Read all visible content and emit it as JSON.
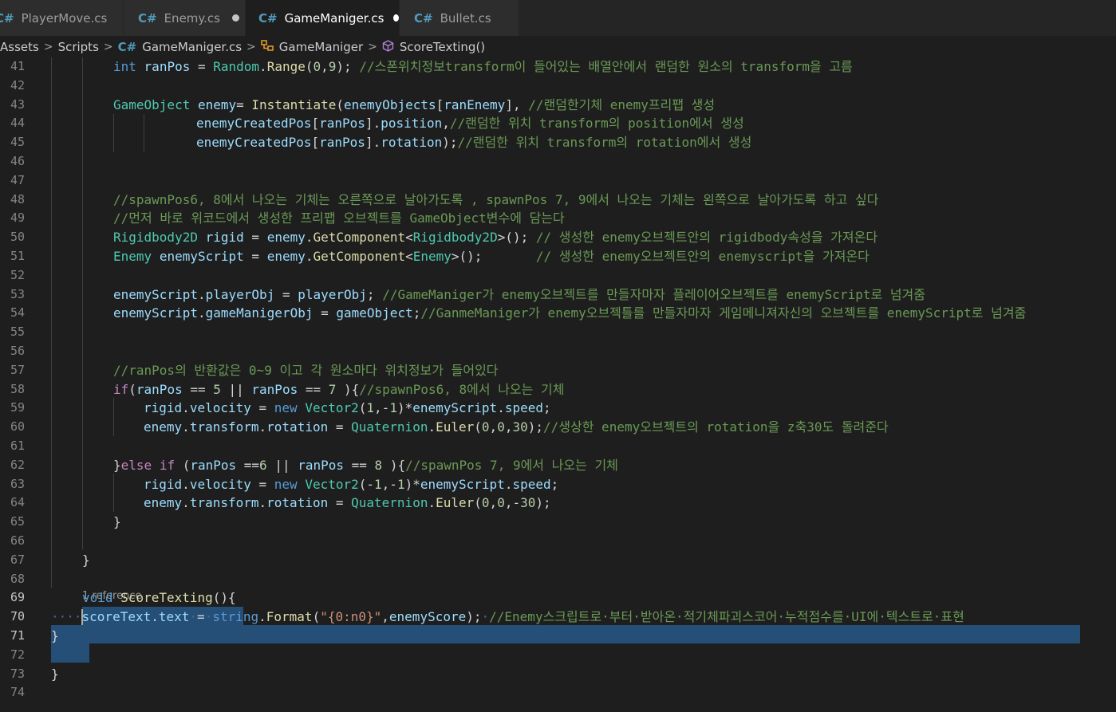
{
  "tabs": [
    {
      "label": "PlayerMove.cs",
      "active": false,
      "modified": false
    },
    {
      "label": "Enemy.cs",
      "active": false,
      "modified": true
    },
    {
      "label": "GameManiger.cs",
      "active": true,
      "modified": true
    },
    {
      "label": "Bullet.cs",
      "active": false,
      "modified": false
    }
  ],
  "file_icon": "C#",
  "breadcrumb": {
    "items": [
      "Assets",
      "Scripts",
      "GameManiger.cs",
      "GameManiger",
      "ScoreTexting()"
    ],
    "separator": ">"
  },
  "codelens": "1 reference",
  "line_numbers": [
    "41",
    "42",
    "43",
    "44",
    "45",
    "46",
    "47",
    "48",
    "49",
    "50",
    "51",
    "52",
    "53",
    "54",
    "55",
    "56",
    "57",
    "58",
    "59",
    "60",
    "61",
    "62",
    "63",
    "64",
    "65",
    "66",
    "67",
    "68",
    "69",
    "70",
    "71",
    "72",
    "73",
    "74"
  ],
  "current_lines": [
    "69",
    "70",
    "71"
  ],
  "colors": {
    "editor_bg": "#1e1e1e",
    "selection": "#264f78",
    "keyword": "#569cd6",
    "type": "#4ec9b0",
    "function": "#dcdcaa",
    "variable": "#9cdcfe",
    "comment": "#6a9955",
    "number": "#b5cea8",
    "string": "#ce9178"
  },
  "code": {
    "l41": [
      [
        "kw",
        "int"
      ],
      [
        "pl",
        " "
      ],
      [
        "id",
        "ranPos"
      ],
      [
        "pl",
        " = "
      ],
      [
        "ty",
        "Random"
      ],
      [
        "pl",
        "."
      ],
      [
        "fn",
        "Range"
      ],
      [
        "pl",
        "("
      ],
      [
        "nu",
        "0"
      ],
      [
        "pl",
        ","
      ],
      [
        "nu",
        "9"
      ],
      [
        "pl",
        "); "
      ],
      [
        "cm",
        "//스폰위치정보transform이 들어있는 배열안에서 랜덤한 원소의 transform을 고름"
      ]
    ],
    "l42": [],
    "l43": [
      [
        "ty",
        "GameObject"
      ],
      [
        "pl",
        " "
      ],
      [
        "id",
        "enemy"
      ],
      [
        "pl",
        "= "
      ],
      [
        "fn",
        "Instantiate"
      ],
      [
        "pl",
        "("
      ],
      [
        "id",
        "enemyObjects"
      ],
      [
        "pl",
        "["
      ],
      [
        "id",
        "ranEnemy"
      ],
      [
        "pl",
        "], "
      ],
      [
        "cm",
        "//랜덤한기체 enemy프리팹 생성"
      ]
    ],
    "l44": [
      [
        "id",
        "enemyCreatedPos"
      ],
      [
        "pl",
        "["
      ],
      [
        "id",
        "ranPos"
      ],
      [
        "pl",
        "]."
      ],
      [
        "id",
        "position"
      ],
      [
        "pl",
        ","
      ],
      [
        "cm",
        "//랜덤한 위치 transform의 position에서 생성"
      ]
    ],
    "l45": [
      [
        "id",
        "enemyCreatedPos"
      ],
      [
        "pl",
        "["
      ],
      [
        "id",
        "ranPos"
      ],
      [
        "pl",
        "]."
      ],
      [
        "id",
        "rotation"
      ],
      [
        "pl",
        ");"
      ],
      [
        "cm",
        "//랜덤한 위치 transform의 rotation에서 생성"
      ]
    ],
    "l46": [],
    "l47": [],
    "l48": [
      [
        "cm",
        "//spawnPos6, 8에서 나오는 기체는 오른쪽으로 날아가도록 , spawnPos 7, 9에서 나오는 기체는 왼쪽으로 날아가도록 하고 싶다"
      ]
    ],
    "l49": [
      [
        "cm",
        "//먼저 바로 위코드에서 생성한 프리팹 오브젝트를 GameObject변수에 담는다"
      ]
    ],
    "l50": [
      [
        "ty",
        "Rigidbody2D"
      ],
      [
        "pl",
        " "
      ],
      [
        "id",
        "rigid"
      ],
      [
        "pl",
        " = "
      ],
      [
        "id",
        "enemy"
      ],
      [
        "pl",
        "."
      ],
      [
        "fn",
        "GetComponent"
      ],
      [
        "pl",
        "<"
      ],
      [
        "ty",
        "Rigidbody2D"
      ],
      [
        "pl",
        ">(); "
      ],
      [
        "cm",
        "// 생성한 enemy오브젝트안의 rigidbody속성을 가져온다"
      ]
    ],
    "l51": [
      [
        "ty",
        "Enemy"
      ],
      [
        "pl",
        " "
      ],
      [
        "id",
        "enemyScript"
      ],
      [
        "pl",
        " = "
      ],
      [
        "id",
        "enemy"
      ],
      [
        "pl",
        "."
      ],
      [
        "fn",
        "GetComponent"
      ],
      [
        "pl",
        "<"
      ],
      [
        "ty",
        "Enemy"
      ],
      [
        "pl",
        ">();       "
      ],
      [
        "cm",
        "// 생성한 enemy오브젝트안의 enemyscript을 가져온다"
      ]
    ],
    "l52": [],
    "l53": [
      [
        "id",
        "enemyScript"
      ],
      [
        "pl",
        "."
      ],
      [
        "id",
        "playerObj"
      ],
      [
        "pl",
        " = "
      ],
      [
        "id",
        "playerObj"
      ],
      [
        "pl",
        "; "
      ],
      [
        "cm",
        "//GameManiger가 enemy오브젝트를 만들자마자 플레이어오브젝트를 enemyScript로 넘겨줌"
      ]
    ],
    "l54": [
      [
        "id",
        "enemyScript"
      ],
      [
        "pl",
        "."
      ],
      [
        "id",
        "gameManigerObj"
      ],
      [
        "pl",
        " = "
      ],
      [
        "id",
        "gameObject"
      ],
      [
        "pl",
        ";"
      ],
      [
        "cm",
        "//GanmeManiger가 enemy오브젝틀를 만들자마자 게임메니져자신의 오브젝트를 enemyScript로 넘겨줌"
      ]
    ],
    "l55": [],
    "l56": [],
    "l57": [
      [
        "cm",
        "//ranPos의 반환값은 0~9 이고 각 원소마다 위치정보가 들어있다"
      ]
    ],
    "l58": [
      [
        "cf",
        "if"
      ],
      [
        "pl",
        "("
      ],
      [
        "id",
        "ranPos"
      ],
      [
        "pl",
        " == "
      ],
      [
        "nu",
        "5"
      ],
      [
        "pl",
        " || "
      ],
      [
        "id",
        "ranPos"
      ],
      [
        "pl",
        " == "
      ],
      [
        "nu",
        "7"
      ],
      [
        "pl",
        " ){"
      ],
      [
        "cm",
        "//spawnPos6, 8에서 나오는 기체"
      ]
    ],
    "l59": [
      [
        "id",
        "rigid"
      ],
      [
        "pl",
        "."
      ],
      [
        "id",
        "velocity"
      ],
      [
        "pl",
        " = "
      ],
      [
        "kw",
        "new"
      ],
      [
        "pl",
        " "
      ],
      [
        "ty",
        "Vector2"
      ],
      [
        "pl",
        "("
      ],
      [
        "nu",
        "1"
      ],
      [
        "pl",
        ",-"
      ],
      [
        "nu",
        "1"
      ],
      [
        "pl",
        ")*"
      ],
      [
        "id",
        "enemyScript"
      ],
      [
        "pl",
        "."
      ],
      [
        "id",
        "speed"
      ],
      [
        "pl",
        ";"
      ]
    ],
    "l60": [
      [
        "id",
        "enemy"
      ],
      [
        "pl",
        "."
      ],
      [
        "id",
        "transform"
      ],
      [
        "pl",
        "."
      ],
      [
        "id",
        "rotation"
      ],
      [
        "pl",
        " = "
      ],
      [
        "ty",
        "Quaternion"
      ],
      [
        "pl",
        "."
      ],
      [
        "fn",
        "Euler"
      ],
      [
        "pl",
        "("
      ],
      [
        "nu",
        "0"
      ],
      [
        "pl",
        ","
      ],
      [
        "nu",
        "0"
      ],
      [
        "pl",
        ","
      ],
      [
        "nu",
        "30"
      ],
      [
        "pl",
        ");"
      ],
      [
        "cm",
        "//생상한 enemy오브젝트의 rotation을 z축30도 돌려준다"
      ]
    ],
    "l61": [],
    "l62": [
      [
        "pl",
        "}"
      ],
      [
        "cf",
        "else"
      ],
      [
        "pl",
        " "
      ],
      [
        "cf",
        "if"
      ],
      [
        "pl",
        " ("
      ],
      [
        "id",
        "ranPos"
      ],
      [
        "pl",
        " =="
      ],
      [
        "nu",
        "6"
      ],
      [
        "pl",
        " || "
      ],
      [
        "id",
        "ranPos"
      ],
      [
        "pl",
        " == "
      ],
      [
        "nu",
        "8"
      ],
      [
        "pl",
        " ){"
      ],
      [
        "cm",
        "//spawnPos 7, 9에서 나오는 기체"
      ]
    ],
    "l63": [
      [
        "id",
        "rigid"
      ],
      [
        "pl",
        "."
      ],
      [
        "id",
        "velocity"
      ],
      [
        "pl",
        " = "
      ],
      [
        "kw",
        "new"
      ],
      [
        "pl",
        " "
      ],
      [
        "ty",
        "Vector2"
      ],
      [
        "pl",
        "(-"
      ],
      [
        "nu",
        "1"
      ],
      [
        "pl",
        ",-"
      ],
      [
        "nu",
        "1"
      ],
      [
        "pl",
        ")*"
      ],
      [
        "id",
        "enemyScript"
      ],
      [
        "pl",
        "."
      ],
      [
        "id",
        "speed"
      ],
      [
        "pl",
        ";"
      ]
    ],
    "l64": [
      [
        "id",
        "enemy"
      ],
      [
        "pl",
        "."
      ],
      [
        "id",
        "transform"
      ],
      [
        "pl",
        "."
      ],
      [
        "id",
        "rotation"
      ],
      [
        "pl",
        " = "
      ],
      [
        "ty",
        "Quaternion"
      ],
      [
        "pl",
        "."
      ],
      [
        "fn",
        "Euler"
      ],
      [
        "pl",
        "("
      ],
      [
        "nu",
        "0"
      ],
      [
        "pl",
        ","
      ],
      [
        "nu",
        "0"
      ],
      [
        "pl",
        ",-"
      ],
      [
        "nu",
        "30"
      ],
      [
        "pl",
        ");"
      ]
    ],
    "l65": [
      [
        "pl",
        "}"
      ]
    ],
    "l66": [],
    "l67": [
      [
        "pl",
        "}"
      ]
    ],
    "l68": [],
    "l69": [
      [
        "kw",
        "void"
      ],
      [
        "pl",
        " "
      ],
      [
        "fn",
        "ScoreTexting"
      ],
      [
        "pl",
        "(){"
      ]
    ],
    "l70": [
      [
        "ws",
        "····"
      ],
      [
        "id",
        "scoreText"
      ],
      [
        "pl",
        "."
      ],
      [
        "id",
        "text"
      ],
      [
        "ws",
        "·"
      ],
      [
        "pl",
        "="
      ],
      [
        "ws",
        "·"
      ],
      [
        "kw",
        "string"
      ],
      [
        "pl",
        "."
      ],
      [
        "fn",
        "Format"
      ],
      [
        "pl",
        "("
      ],
      [
        "st",
        "\"{0:n0}\""
      ],
      [
        "pl",
        ","
      ],
      [
        "id",
        "enemyScore"
      ],
      [
        "pl",
        ");"
      ],
      [
        "ws",
        "·"
      ],
      [
        "cm",
        "//Enemy스크립트로·부터·받아온·적기체파괴스코어·누적점수를·UI에·텍스트로·표현"
      ]
    ],
    "l71": [
      [
        "pl",
        "}"
      ]
    ],
    "l72": [],
    "l73": [
      [
        "pl",
        "}"
      ]
    ],
    "l74": []
  }
}
